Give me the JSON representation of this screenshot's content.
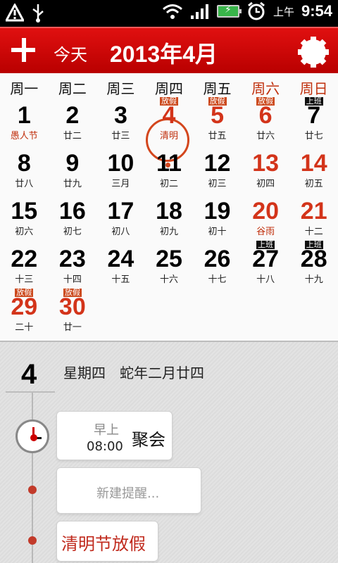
{
  "status_bar": {
    "ampm": "上午",
    "time": "9:54"
  },
  "header": {
    "today_label": "今天",
    "month_title": "2013年4月"
  },
  "weekdays": [
    "周一",
    "周二",
    "周三",
    "周四",
    "周五",
    "周六",
    "周日"
  ],
  "days": [
    {
      "num": "1",
      "lunar": "愚人节",
      "lunar_red": true
    },
    {
      "num": "2",
      "lunar": "廿二"
    },
    {
      "num": "3",
      "lunar": "廿三"
    },
    {
      "num": "4",
      "lunar": "清明",
      "lunar_red": true,
      "badge": "放假",
      "today": true,
      "red": true
    },
    {
      "num": "5",
      "lunar": "廿五",
      "badge": "放假",
      "red": true
    },
    {
      "num": "6",
      "lunar": "廿六",
      "badge": "放假",
      "red": true
    },
    {
      "num": "7",
      "lunar": "廿七",
      "badge": "上班",
      "work": true
    },
    {
      "num": "8",
      "lunar": "廿八"
    },
    {
      "num": "9",
      "lunar": "廿九"
    },
    {
      "num": "10",
      "lunar": "三月"
    },
    {
      "num": "11",
      "lunar": "初二"
    },
    {
      "num": "12",
      "lunar": "初三"
    },
    {
      "num": "13",
      "lunar": "初四",
      "red": true
    },
    {
      "num": "14",
      "lunar": "初五",
      "red": true
    },
    {
      "num": "15",
      "lunar": "初六"
    },
    {
      "num": "16",
      "lunar": "初七"
    },
    {
      "num": "17",
      "lunar": "初八"
    },
    {
      "num": "18",
      "lunar": "初九"
    },
    {
      "num": "19",
      "lunar": "初十"
    },
    {
      "num": "20",
      "lunar": "谷雨",
      "lunar_red": true,
      "red": true
    },
    {
      "num": "21",
      "lunar": "十二",
      "red": true
    },
    {
      "num": "22",
      "lunar": "十三"
    },
    {
      "num": "23",
      "lunar": "十四"
    },
    {
      "num": "24",
      "lunar": "十五"
    },
    {
      "num": "25",
      "lunar": "十六"
    },
    {
      "num": "26",
      "lunar": "十七"
    },
    {
      "num": "27",
      "lunar": "十八",
      "badge": "上班",
      "work": true
    },
    {
      "num": "28",
      "lunar": "十九",
      "badge": "上班",
      "work": true
    },
    {
      "num": "29",
      "lunar": "二十",
      "badge": "放假",
      "red": true
    },
    {
      "num": "30",
      "lunar": "廿一",
      "badge": "放假",
      "red": true
    }
  ],
  "detail": {
    "day": "4",
    "info": "星期四　蛇年二月廿四",
    "event": {
      "period": "早上",
      "time": "08:00",
      "title": "聚会"
    },
    "new_reminder": "新建提醒...",
    "holiday": "清明节放假"
  }
}
